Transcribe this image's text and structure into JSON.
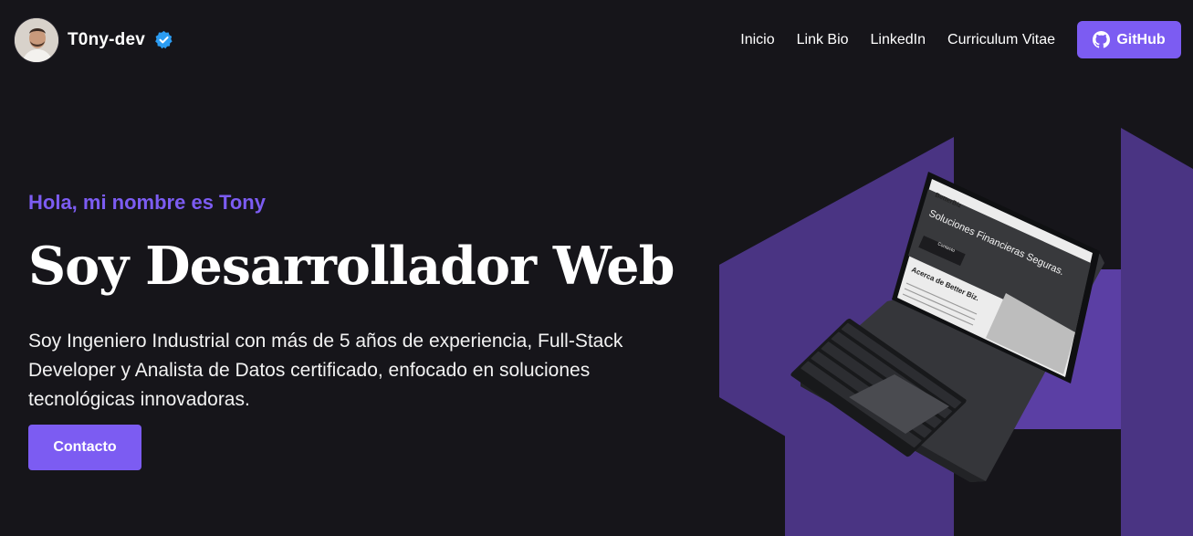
{
  "navbar": {
    "brand_name": "T0ny-dev",
    "links": [
      "Inicio",
      "Link Bio",
      "LinkedIn",
      "Curriculum Vitae"
    ],
    "github_label": "GitHub"
  },
  "hero": {
    "greeting": "Hola, mi nombre es Tony",
    "title": "Soy Desarrollador Web",
    "description": "Soy Ingeniero Industrial con más de 5 años de experiencia, Full-Stack Developer y Analista de Datos certificado, enfocado en soluciones tecnológicas innovadoras.",
    "contact_label": "Contacto"
  },
  "laptop_screen": {
    "logo_text": "BetterBiz",
    "hero_text": "Soluciones Financieras Seguras.",
    "button_text": "Contacto",
    "section_title": "Acerca de Better Biz."
  },
  "colors": {
    "background": "#16151a",
    "accent": "#7c5cf2",
    "shape_purple": "#4a3483",
    "verified_blue": "#2b9cf2"
  },
  "icons": [
    "verified-badge-icon",
    "github-icon"
  ]
}
